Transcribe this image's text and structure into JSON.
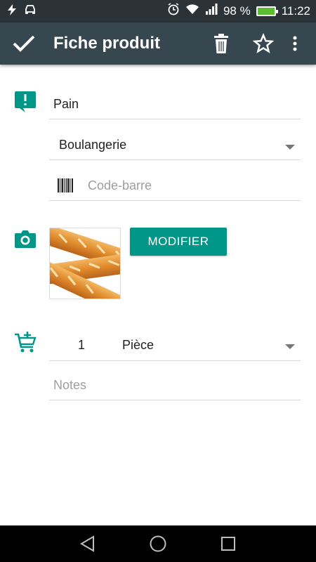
{
  "status_bar": {
    "battery_percent": "98 %",
    "time": "11:22"
  },
  "app_bar": {
    "title": "Fiche produit"
  },
  "form": {
    "name_value": "Pain",
    "category_value": "Boulangerie",
    "barcode_placeholder": "Code-barre",
    "photo_button_label": "MODIFIER",
    "quantity_value": "1",
    "unit_value": "Pièce",
    "notes_placeholder": "Notes"
  },
  "colors": {
    "accent": "#009688",
    "app_bar": "#37474f",
    "status_bar": "#2b3338"
  }
}
